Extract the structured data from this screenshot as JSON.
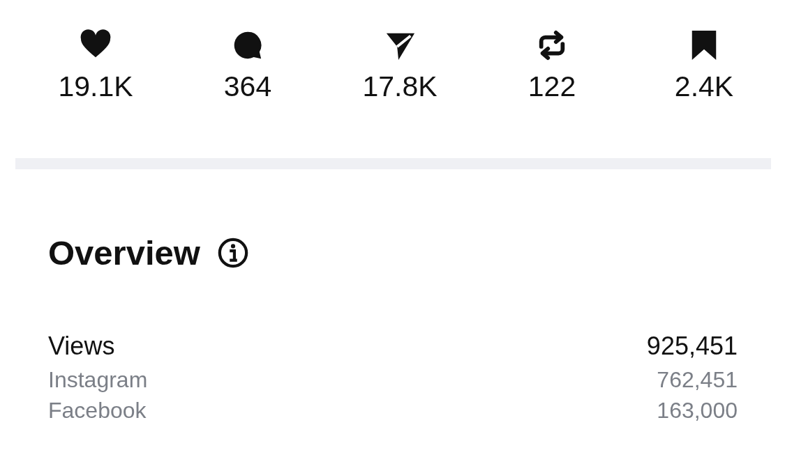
{
  "stats": [
    {
      "kind": "like",
      "count": "19.1K"
    },
    {
      "kind": "comment",
      "count": "364"
    },
    {
      "kind": "share",
      "count": "17.8K"
    },
    {
      "kind": "repost",
      "count": "122"
    },
    {
      "kind": "save",
      "count": "2.4K"
    }
  ],
  "overview": {
    "title": "Overview",
    "rows": [
      {
        "kind": "total",
        "label": "Views",
        "value": "925,451"
      },
      {
        "kind": "source",
        "label": "Instagram",
        "value": "762,451"
      },
      {
        "kind": "source",
        "label": "Facebook",
        "value": "163,000"
      }
    ]
  }
}
